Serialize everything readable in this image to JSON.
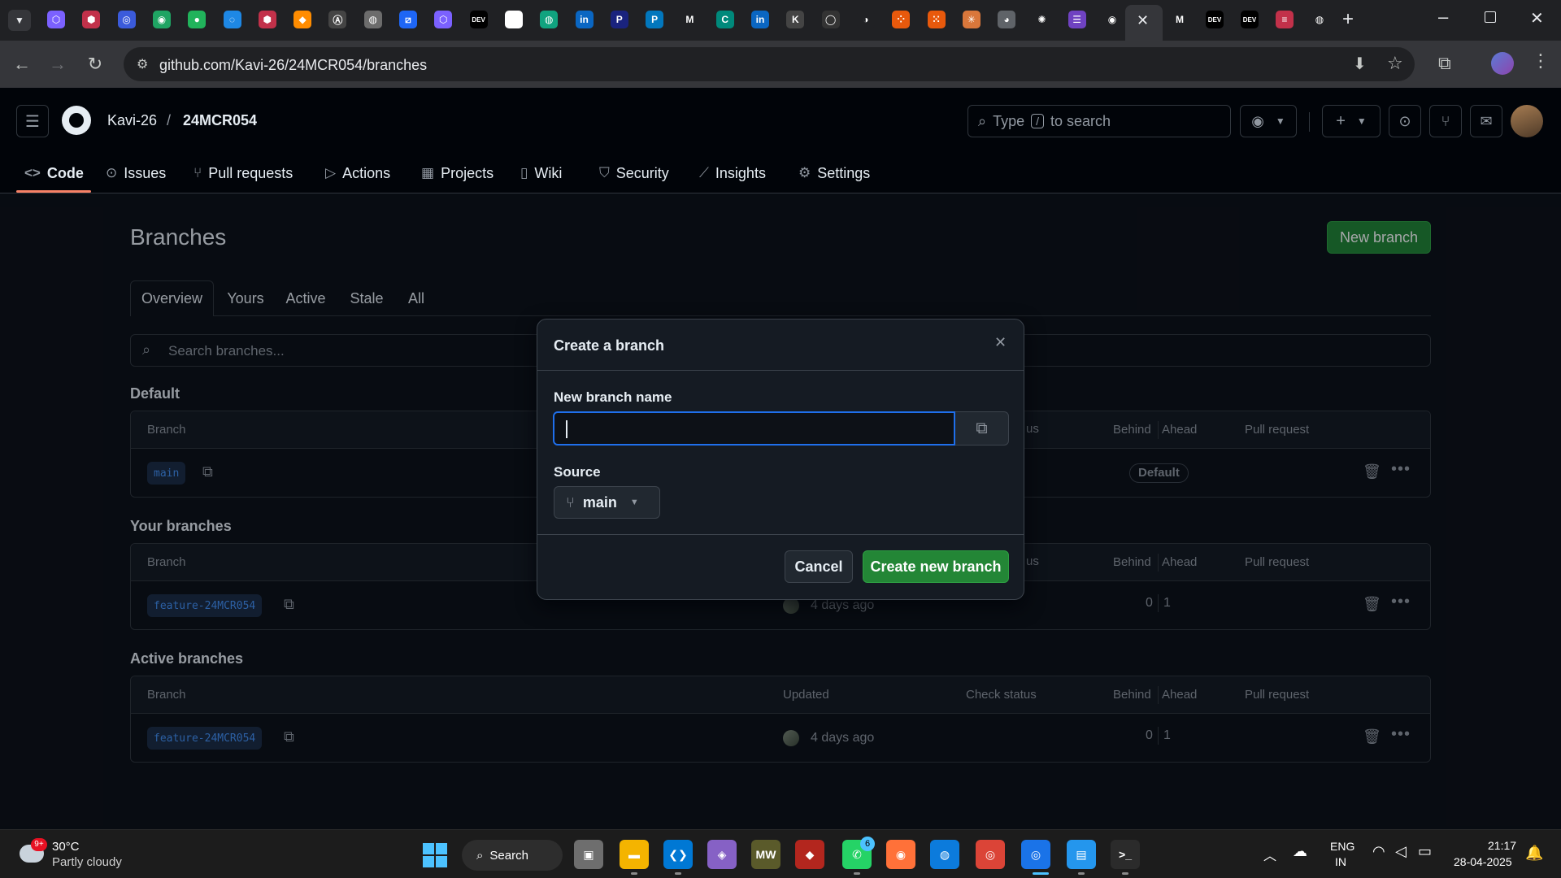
{
  "browser": {
    "url": "github.com/Kavi-26/24MCR054/branches",
    "tab_icons": [
      {
        "name": "ext-cube-icon",
        "color": "#7b61ff",
        "glyph": "⬡"
      },
      {
        "name": "ext-shield-icon",
        "color": "#c2314a",
        "glyph": "⬢"
      },
      {
        "name": "ext-gfg-icon",
        "color": "#3b5bdb",
        "glyph": "◎"
      },
      {
        "name": "ext-leaf-icon",
        "color": "#1fa463",
        "glyph": "◉"
      },
      {
        "name": "ext-drop-icon",
        "color": "#21b35b",
        "glyph": "●"
      },
      {
        "name": "ext-ring-icon",
        "color": "#1e88e5",
        "glyph": "◌"
      },
      {
        "name": "ext-hex-icon",
        "color": "#c2314a",
        "glyph": "⬢"
      },
      {
        "name": "ext-flame-icon",
        "color": "#ff8c00",
        "glyph": "◆"
      },
      {
        "name": "ext-a-icon",
        "color": "#444",
        "glyph": "Ⓐ"
      },
      {
        "name": "ext-user-icon",
        "color": "#6c6c6c",
        "glyph": "◍"
      },
      {
        "name": "ext-slash-icon",
        "color": "#1e66f5",
        "glyph": "⧄"
      },
      {
        "name": "ext-box-icon",
        "color": "#7b61ff",
        "glyph": "⬡"
      },
      {
        "name": "dev-icon",
        "color": "#000",
        "glyph": "DEV"
      },
      {
        "name": "ext-swirl-icon",
        "color": "#fff",
        "glyph": "◐"
      },
      {
        "name": "ext-ai-icon",
        "color": "#10a37f",
        "glyph": "◍"
      },
      {
        "name": "linkedin-icon",
        "color": "#0a66c2",
        "glyph": "in"
      },
      {
        "name": "ext-p-icon",
        "color": "#1a237e",
        "glyph": "P"
      },
      {
        "name": "ext-p2-icon",
        "color": "#0277bd",
        "glyph": "P"
      },
      {
        "name": "gmail-icon",
        "color": "#202124",
        "glyph": "M"
      },
      {
        "name": "ext-c-icon",
        "color": "#00897b",
        "glyph": "C"
      },
      {
        "name": "linkedin-2-icon",
        "color": "#0a66c2",
        "glyph": "in"
      },
      {
        "name": "ext-k-icon",
        "color": "#444",
        "glyph": "K"
      },
      {
        "name": "github-ghost-icon",
        "color": "#333",
        "glyph": "◯"
      },
      {
        "name": "copilot-icon",
        "color": "#202124",
        "glyph": "◑"
      },
      {
        "name": "ext-dots-icon",
        "color": "#e8590c",
        "glyph": "⁘"
      },
      {
        "name": "ext-dots2-icon",
        "color": "#e8590c",
        "glyph": "⁙"
      },
      {
        "name": "claude-icon",
        "color": "#d9773b",
        "glyph": "✳"
      },
      {
        "name": "ext-globe-icon",
        "color": "#5f6368",
        "glyph": "◕"
      },
      {
        "name": "openai-icon",
        "color": "#202124",
        "glyph": "✺"
      },
      {
        "name": "ext-list-icon",
        "color": "#6f42c1",
        "glyph": "☰"
      },
      {
        "name": "github-icon",
        "color": "#202124",
        "glyph": "◉"
      }
    ],
    "tab_icons_after": [
      {
        "name": "gmail-2-icon",
        "color": "#202124",
        "glyph": "M"
      },
      {
        "name": "dev-2-icon",
        "color": "#000",
        "glyph": "DEV"
      },
      {
        "name": "dev-3-icon",
        "color": "#000",
        "glyph": "DEV"
      },
      {
        "name": "ext-stack-icon",
        "color": "#c2314a",
        "glyph": "≡"
      },
      {
        "name": "chrome-icon",
        "color": "#202124",
        "glyph": "◍"
      }
    ]
  },
  "header": {
    "owner": "Kavi-26",
    "separator": "/",
    "repo": "24MCR054",
    "search_prefix": "Type",
    "search_key": "/",
    "search_suffix": "to search"
  },
  "nav": [
    {
      "label": "Code",
      "icon": "code-icon",
      "glyph": "<>"
    },
    {
      "label": "Issues",
      "icon": "issue-icon",
      "glyph": "⊙"
    },
    {
      "label": "Pull requests",
      "icon": "pull-request-icon",
      "glyph": "⑂"
    },
    {
      "label": "Actions",
      "icon": "play-icon",
      "glyph": "▷"
    },
    {
      "label": "Projects",
      "icon": "table-icon",
      "glyph": "▦"
    },
    {
      "label": "Wiki",
      "icon": "book-icon",
      "glyph": "▯"
    },
    {
      "label": "Security",
      "icon": "shield-icon",
      "glyph": "⛉"
    },
    {
      "label": "Insights",
      "icon": "graph-icon",
      "glyph": "⟋"
    },
    {
      "label": "Settings",
      "icon": "gear-icon",
      "glyph": "⚙"
    }
  ],
  "page": {
    "title": "Branches",
    "new_branch": "New branch",
    "tabs": [
      "Overview",
      "Yours",
      "Active",
      "Stale",
      "All"
    ],
    "search_placeholder": "Search branches..."
  },
  "columns": {
    "branch": "Branch",
    "updated": "Updated",
    "check": "Check status",
    "behind": "Behind",
    "ahead": "Ahead",
    "pr": "Pull request"
  },
  "sections": {
    "default": {
      "title": "Default",
      "row": {
        "name": "main",
        "badge": "Default"
      }
    },
    "yours": {
      "title": "Your branches",
      "row": {
        "name": "feature-24MCR054",
        "updated": "4 days ago",
        "behind": "0",
        "ahead": "1"
      }
    },
    "active": {
      "title": "Active branches",
      "row": {
        "name": "feature-24MCR054",
        "updated": "4 days ago",
        "behind": "0",
        "ahead": "1"
      }
    }
  },
  "modal": {
    "title": "Create a branch",
    "name_label": "New branch name",
    "name_value": "",
    "source_label": "Source",
    "source_value": "main",
    "cancel": "Cancel",
    "create": "Create new branch"
  },
  "taskbar": {
    "weather_temp": "30°C",
    "weather_desc": "Partly cloudy",
    "weather_badge": "9+",
    "search": "Search",
    "whatsapp_badge": "6",
    "lang_top": "ENG",
    "lang_bottom": "IN",
    "time": "21:17",
    "date": "28-04-2025"
  },
  "colors": {
    "accent_green": "#238636",
    "link_blue": "#4493f8",
    "bg": "#0d1117"
  }
}
